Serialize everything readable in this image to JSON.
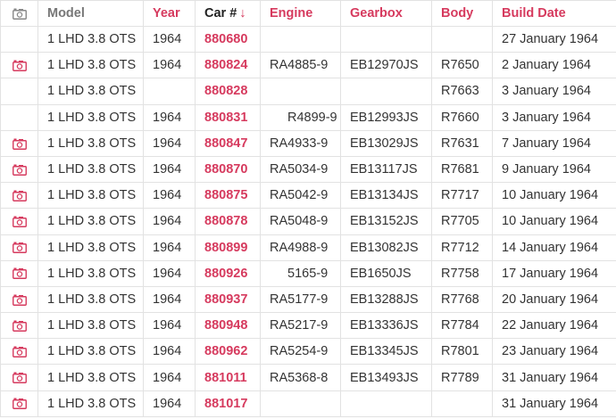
{
  "colors": {
    "accent": "#d63a5e",
    "header_grey": "#777777",
    "text": "#333333",
    "border": "#e2e2e2"
  },
  "columns": [
    {
      "key": "photo",
      "icon": "camera-icon"
    },
    {
      "key": "model",
      "label": "Model"
    },
    {
      "key": "year",
      "label": "Year"
    },
    {
      "key": "car",
      "label": "Car #",
      "sort_indicator": "↓"
    },
    {
      "key": "engine",
      "label": "Engine"
    },
    {
      "key": "gearbox",
      "label": "Gearbox"
    },
    {
      "key": "body",
      "label": "Body"
    },
    {
      "key": "build_date",
      "label": "Build Date"
    }
  ],
  "rows": [
    {
      "photo": false,
      "model": "1 LHD 3.8 OTS",
      "year": "1964",
      "car": "880680",
      "engine": "",
      "gearbox": "",
      "body": "",
      "build_date": "27 January 1964"
    },
    {
      "photo": true,
      "model": "1 LHD 3.8 OTS",
      "year": "1964",
      "car": "880824",
      "engine": "RA4885-9",
      "gearbox": "EB12970JS",
      "body": "R7650",
      "build_date": "2 January 1964"
    },
    {
      "photo": false,
      "model": "1 LHD 3.8 OTS",
      "year": "",
      "car": "880828",
      "engine": "",
      "gearbox": "",
      "body": "R7663",
      "build_date": "3 January 1964"
    },
    {
      "photo": false,
      "model": "1 LHD 3.8 OTS",
      "year": "1964",
      "car": "880831",
      "engine": "R4899-9",
      "gearbox": "EB12993JS",
      "body": "R7660",
      "build_date": "3 January 1964"
    },
    {
      "photo": true,
      "model": "1 LHD 3.8 OTS",
      "year": "1964",
      "car": "880847",
      "engine": "RA4933-9",
      "gearbox": "EB13029JS",
      "body": "R7631",
      "build_date": "7 January 1964"
    },
    {
      "photo": true,
      "model": "1 LHD 3.8 OTS",
      "year": "1964",
      "car": "880870",
      "engine": "RA5034-9",
      "gearbox": "EB13117JS",
      "body": "R7681",
      "build_date": "9 January 1964"
    },
    {
      "photo": true,
      "model": "1 LHD 3.8 OTS",
      "year": "1964",
      "car": "880875",
      "engine": "RA5042-9",
      "gearbox": "EB13134JS",
      "body": "R7717",
      "build_date": "10 January 1964"
    },
    {
      "photo": true,
      "model": "1 LHD 3.8 OTS",
      "year": "1964",
      "car": "880878",
      "engine": "RA5048-9",
      "gearbox": "EB13152JS",
      "body": "R7705",
      "build_date": "10 January 1964"
    },
    {
      "photo": true,
      "model": "1 LHD 3.8 OTS",
      "year": "1964",
      "car": "880899",
      "engine": "RA4988-9",
      "gearbox": "EB13082JS",
      "body": "R7712",
      "build_date": "14 January 1964"
    },
    {
      "photo": true,
      "model": "1 LHD 3.8 OTS",
      "year": "1964",
      "car": "880926",
      "engine": "5165-9",
      "gearbox": "EB1650JS",
      "body": "R7758",
      "build_date": "17 January 1964"
    },
    {
      "photo": true,
      "model": "1 LHD 3.8 OTS",
      "year": "1964",
      "car": "880937",
      "engine": "RA5177-9",
      "gearbox": "EB13288JS",
      "body": "R7768",
      "build_date": "20 January 1964"
    },
    {
      "photo": true,
      "model": "1 LHD 3.8 OTS",
      "year": "1964",
      "car": "880948",
      "engine": "RA5217-9",
      "gearbox": "EB13336JS",
      "body": "R7784",
      "build_date": "22 January 1964"
    },
    {
      "photo": true,
      "model": "1 LHD 3.8 OTS",
      "year": "1964",
      "car": "880962",
      "engine": "RA5254-9",
      "gearbox": "EB13345JS",
      "body": "R7801",
      "build_date": "23 January 1964"
    },
    {
      "photo": true,
      "model": "1 LHD 3.8 OTS",
      "year": "1964",
      "car": "881011",
      "engine": "RA5368-8",
      "gearbox": "EB13493JS",
      "body": "R7789",
      "build_date": "31 January 1964"
    },
    {
      "photo": true,
      "model": "1 LHD 3.8 OTS",
      "year": "1964",
      "car": "881017",
      "engine": "",
      "gearbox": "",
      "body": "",
      "build_date": "31 January 1964"
    }
  ]
}
